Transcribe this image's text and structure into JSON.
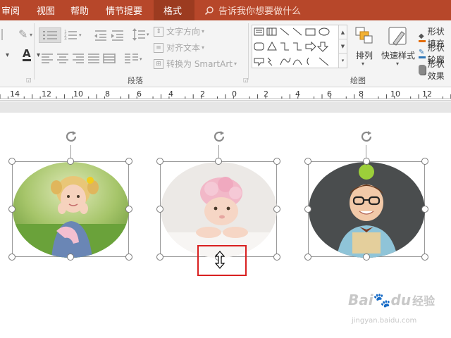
{
  "tabs": [
    {
      "label": "审阅",
      "active": false
    },
    {
      "label": "视图",
      "active": false
    },
    {
      "label": "帮助",
      "active": false
    },
    {
      "label": "情节提要",
      "active": false
    },
    {
      "label": "格式",
      "active": true
    }
  ],
  "tell_me": {
    "text": "告诉我你想要做什么",
    "icon": "search-icon"
  },
  "ribbon": {
    "paragraph": {
      "label": "段落",
      "text_direction": "文字方向",
      "align_text": "对齐文本",
      "convert_smartart": "转换为 SmartArt"
    },
    "drawing": {
      "label": "绘图",
      "arrange": "排列",
      "quick_styles": "快速样式",
      "shape_fill": "形状填充",
      "shape_outline": "形状轮廓",
      "shape_effects": "形状效果"
    },
    "font_color_label": "A"
  },
  "ruler": {
    "numbers": [
      "14",
      "12",
      "10",
      "8",
      "6",
      "4",
      "2",
      "0",
      "2",
      "4",
      "6",
      "8",
      "10",
      "12"
    ]
  },
  "slide": {
    "pictures": [
      {
        "name": "girl-photo",
        "subject": "little girl in denim"
      },
      {
        "name": "baby-photo",
        "subject": "baby with pink flower hat"
      },
      {
        "name": "boy-photo",
        "subject": "boy with glasses and apple"
      }
    ],
    "cursor": "resize-vertical-cursor"
  },
  "watermark": {
    "logo": "Bai",
    "logo2": "du",
    "logo_cn": "经验",
    "url": "jingyan.baidu.com"
  },
  "colors": {
    "tab_bar": "#b7472a",
    "highlight": "#d92020",
    "ribbon": "#f4f4f4"
  }
}
